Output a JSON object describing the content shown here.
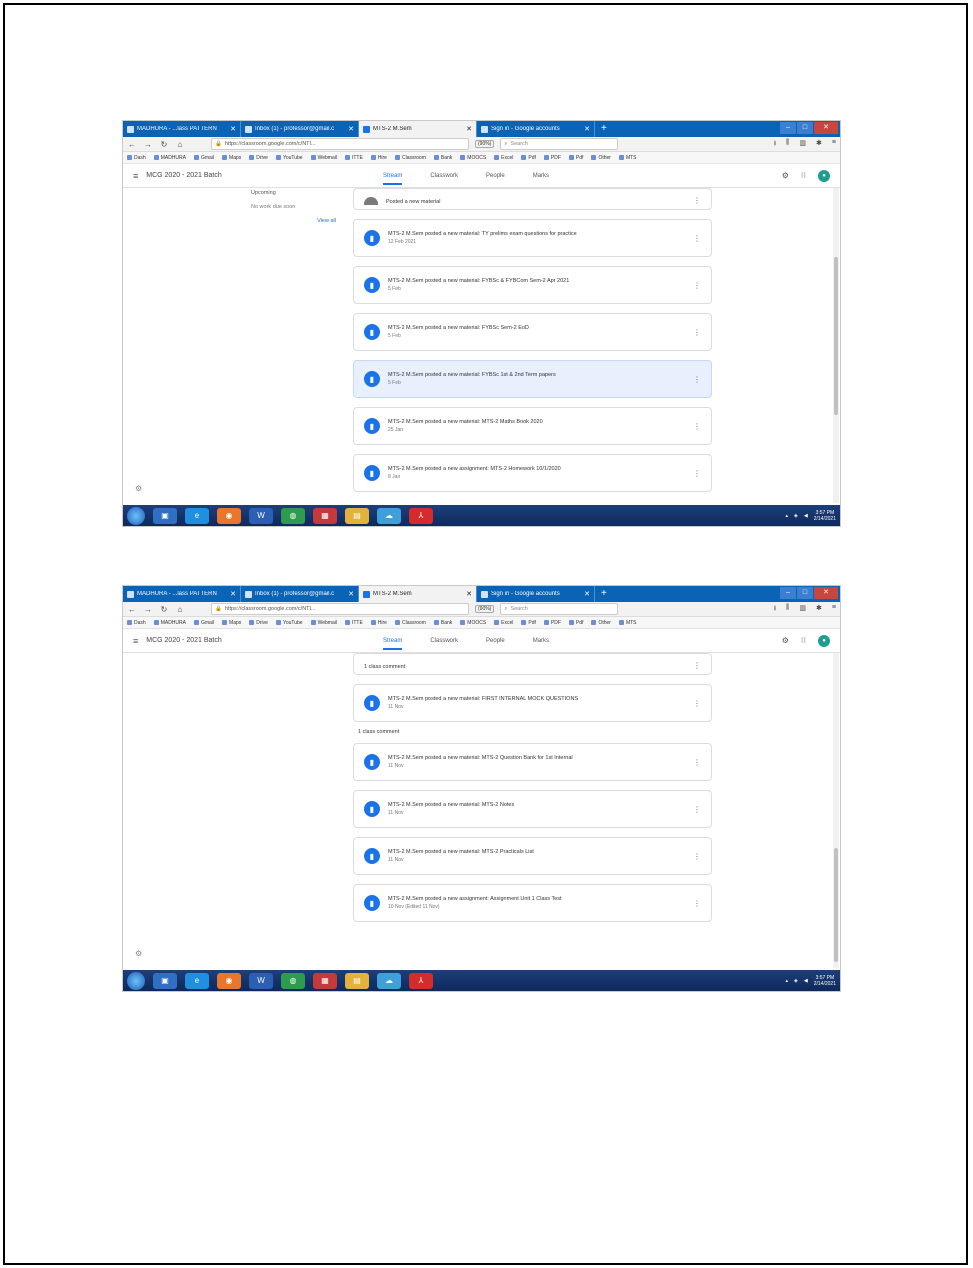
{
  "screenshots": [
    {
      "browser_tabs": [
        {
          "label": "MADHURA - ...lass PATTERN",
          "active": false
        },
        {
          "label": "Inbox (1) - professor@gmail.c",
          "active": false
        },
        {
          "label": "MTS-2 M.Sem",
          "active": true
        },
        {
          "label": "Sign in - Google accounts",
          "active": false
        }
      ],
      "url": "https://classroom.google.com/c/NTI...",
      "zoom": "(90%)",
      "search_placeholder": "Search",
      "bookmarks": [
        "Dash",
        "MADHURA",
        "Gmail",
        "Maps",
        "Drive",
        "YouTube",
        "Webmail",
        "ITTE",
        "Hire",
        "Classroom",
        "Bank",
        "MOOCS",
        "Excel",
        "Pdf",
        "PDF",
        "Pdf",
        "Other",
        "MTS"
      ],
      "class_title": "MCG 2020 - 2021 Batch",
      "app_tabs": [
        "Stream",
        "Classwork",
        "People",
        "Marks"
      ],
      "sidebar": {
        "upcoming": "Upcoming",
        "no_work": "No work due soon",
        "view_all": "View all"
      },
      "feed": [
        {
          "type": "partial-top",
          "title": "Posted a new material",
          "date": ""
        },
        {
          "type": "card",
          "title": "MTS-2 M.Sem posted a new material: TY prelims exam questions for practice",
          "date": "12 Feb 2021",
          "highlight": false
        },
        {
          "type": "card",
          "title": "MTS-2 M.Sem posted a new material: FYBSc & FYBCom Sem-2 Apr 2021",
          "date": "5 Feb",
          "highlight": false
        },
        {
          "type": "card",
          "title": "MTS-2 M.Sem posted a new material: FYBSc Sem-2 EoD",
          "date": "5 Feb",
          "highlight": false
        },
        {
          "type": "card",
          "title": "MTS-2 M.Sem posted a new material: FYBSc 1st & 2nd Term papers",
          "date": "5 Feb",
          "highlight": true
        },
        {
          "type": "card",
          "title": "MTS-2 M.Sem posted a new material: MTS-2 Maths Book 2020",
          "date": "25 Jan",
          "highlight": false
        },
        {
          "type": "card",
          "title": "MTS-2 M.Sem posted a new assignment: MTS-2 Homework 10/1/2020",
          "date": "8 Jan",
          "highlight": false
        }
      ],
      "scroll": {
        "top": 0.22,
        "size": 0.5
      },
      "taskbar_clock": [
        "3:57 PM",
        "2/14/2021"
      ]
    },
    {
      "browser_tabs": [
        {
          "label": "MADHURA - ...lass PATTERN",
          "active": false
        },
        {
          "label": "Inbox (1) - professor@gmail.c",
          "active": false
        },
        {
          "label": "MTS-2 M.Sem",
          "active": true
        },
        {
          "label": "Sign in - Google accounts",
          "active": false
        }
      ],
      "url": "https://classroom.google.com/c/NTI...",
      "zoom": "(90%)",
      "search_placeholder": "Search",
      "bookmarks": [
        "Dash",
        "MADHURA",
        "Gmail",
        "Maps",
        "Drive",
        "YouTube",
        "Webmail",
        "ITTE",
        "Hire",
        "Classroom",
        "Bank",
        "MOOCS",
        "Excel",
        "Pdf",
        "PDF",
        "Pdf",
        "Other",
        "MTS"
      ],
      "class_title": "MCG 2020 - 2021 Batch",
      "app_tabs": [
        "Stream",
        "Classwork",
        "People",
        "Marks"
      ],
      "feed": [
        {
          "type": "partial-top",
          "title": "1 class comment",
          "date": ""
        },
        {
          "type": "card",
          "title": "MTS-2 M.Sem posted a new material: FIRST INTERNAL MOCK QUESTIONS",
          "date": "11 Nov",
          "highlight": false
        },
        {
          "type": "label",
          "title": "1 class comment"
        },
        {
          "type": "card",
          "title": "MTS-2 M.Sem posted a new material: MTS-2 Question Bank for 1st Internal",
          "date": "11 Nov",
          "highlight": false
        },
        {
          "type": "card",
          "title": "MTS-2 M.Sem posted a new material: MTS-2 Notes",
          "date": "11 Nov",
          "highlight": false
        },
        {
          "type": "card",
          "title": "MTS-2 M.Sem posted a new material: MTS-2 Practicals List",
          "date": "11 Nov",
          "highlight": false
        },
        {
          "type": "card",
          "title": "MTS-2 M.Sem posted a new assignment: Assignment Unit 1 Class Test",
          "date": "10 Nov (Edited 11 Nov)",
          "highlight": false
        }
      ],
      "scroll": {
        "top": 0.62,
        "size": 0.36
      },
      "taskbar_clock": [
        "3:57 PM",
        "2/14/2021"
      ]
    }
  ]
}
